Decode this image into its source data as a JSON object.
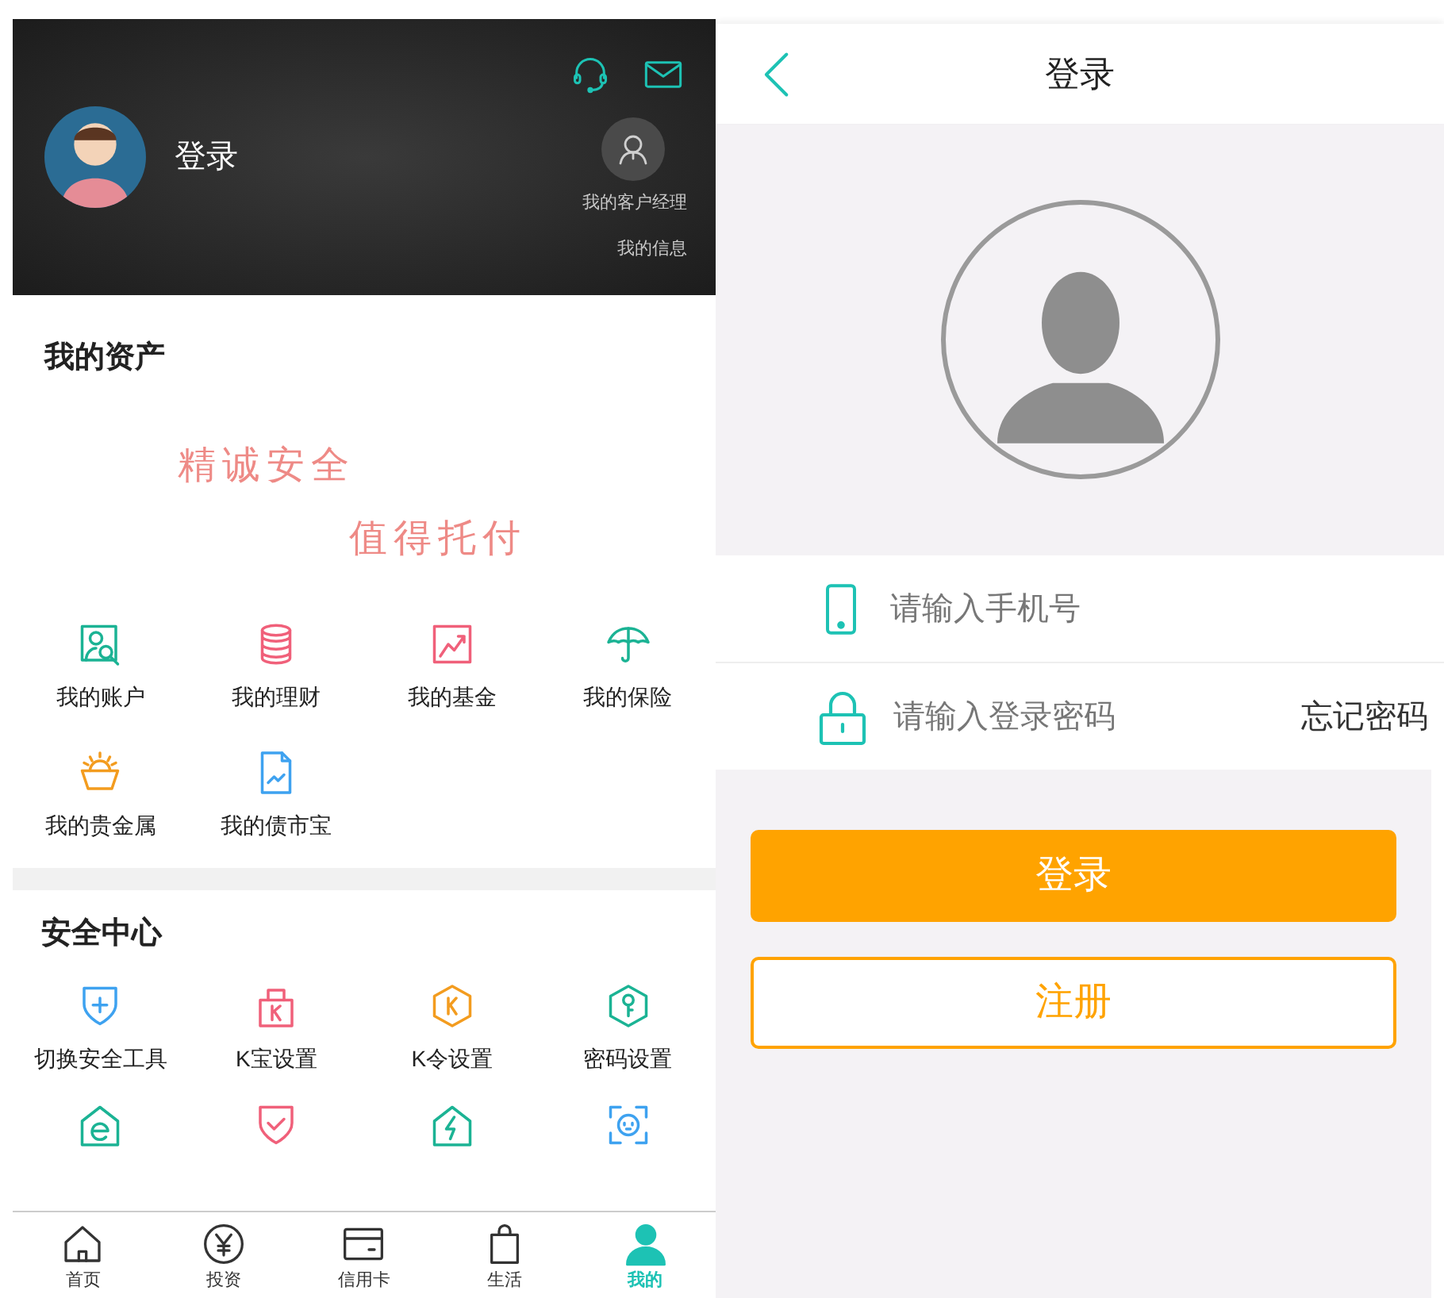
{
  "profile": {
    "login_label": "登录",
    "manager_label": "我的客户经理",
    "info_label": "我的信息"
  },
  "assets": {
    "title": "我的资产",
    "slogan": [
      "精诚安全",
      "值得托付"
    ],
    "items": [
      {
        "label": "我的账户",
        "kind": "account",
        "color": "#1bb394"
      },
      {
        "label": "我的理财",
        "kind": "coins",
        "color": "#f0607a"
      },
      {
        "label": "我的基金",
        "kind": "chart",
        "color": "#f0607a"
      },
      {
        "label": "我的保险",
        "kind": "umbrella",
        "color": "#1bb394"
      },
      {
        "label": "我的贵金属",
        "kind": "basket",
        "color": "#f39c1f"
      },
      {
        "label": "我的债市宝",
        "kind": "document",
        "color": "#3ea2f0"
      }
    ]
  },
  "security": {
    "title": "安全中心",
    "items": [
      {
        "label": "切换安全工具",
        "kind": "shield-plus",
        "color": "#3ea2f0"
      },
      {
        "label": "K宝设置",
        "kind": "k-lock",
        "color": "#f0607a"
      },
      {
        "label": "K令设置",
        "kind": "k-hex",
        "color": "#f39c1f"
      },
      {
        "label": "密码设置",
        "kind": "key-hex",
        "color": "#1bb394"
      },
      {
        "kind": "e-house",
        "color": "#1bb394"
      },
      {
        "kind": "shield-check",
        "color": "#f0607a"
      },
      {
        "kind": "bolt-house",
        "color": "#1bb394"
      },
      {
        "kind": "face-scan",
        "color": "#3ea2f0"
      }
    ]
  },
  "tab_bar": [
    {
      "label": "首页",
      "kind": "home",
      "selected": false
    },
    {
      "label": "投资",
      "kind": "yen",
      "selected": false
    },
    {
      "label": "信用卡",
      "kind": "card",
      "selected": false
    },
    {
      "label": "生活",
      "kind": "bag",
      "selected": false
    },
    {
      "label": "我的",
      "kind": "person",
      "selected": true
    }
  ],
  "login": {
    "title": "登录",
    "phone_placeholder": "请输入手机号",
    "password_placeholder": "请输入登录密码",
    "forgot": "忘记密码",
    "login_button": "登录",
    "register_button": "注册"
  }
}
